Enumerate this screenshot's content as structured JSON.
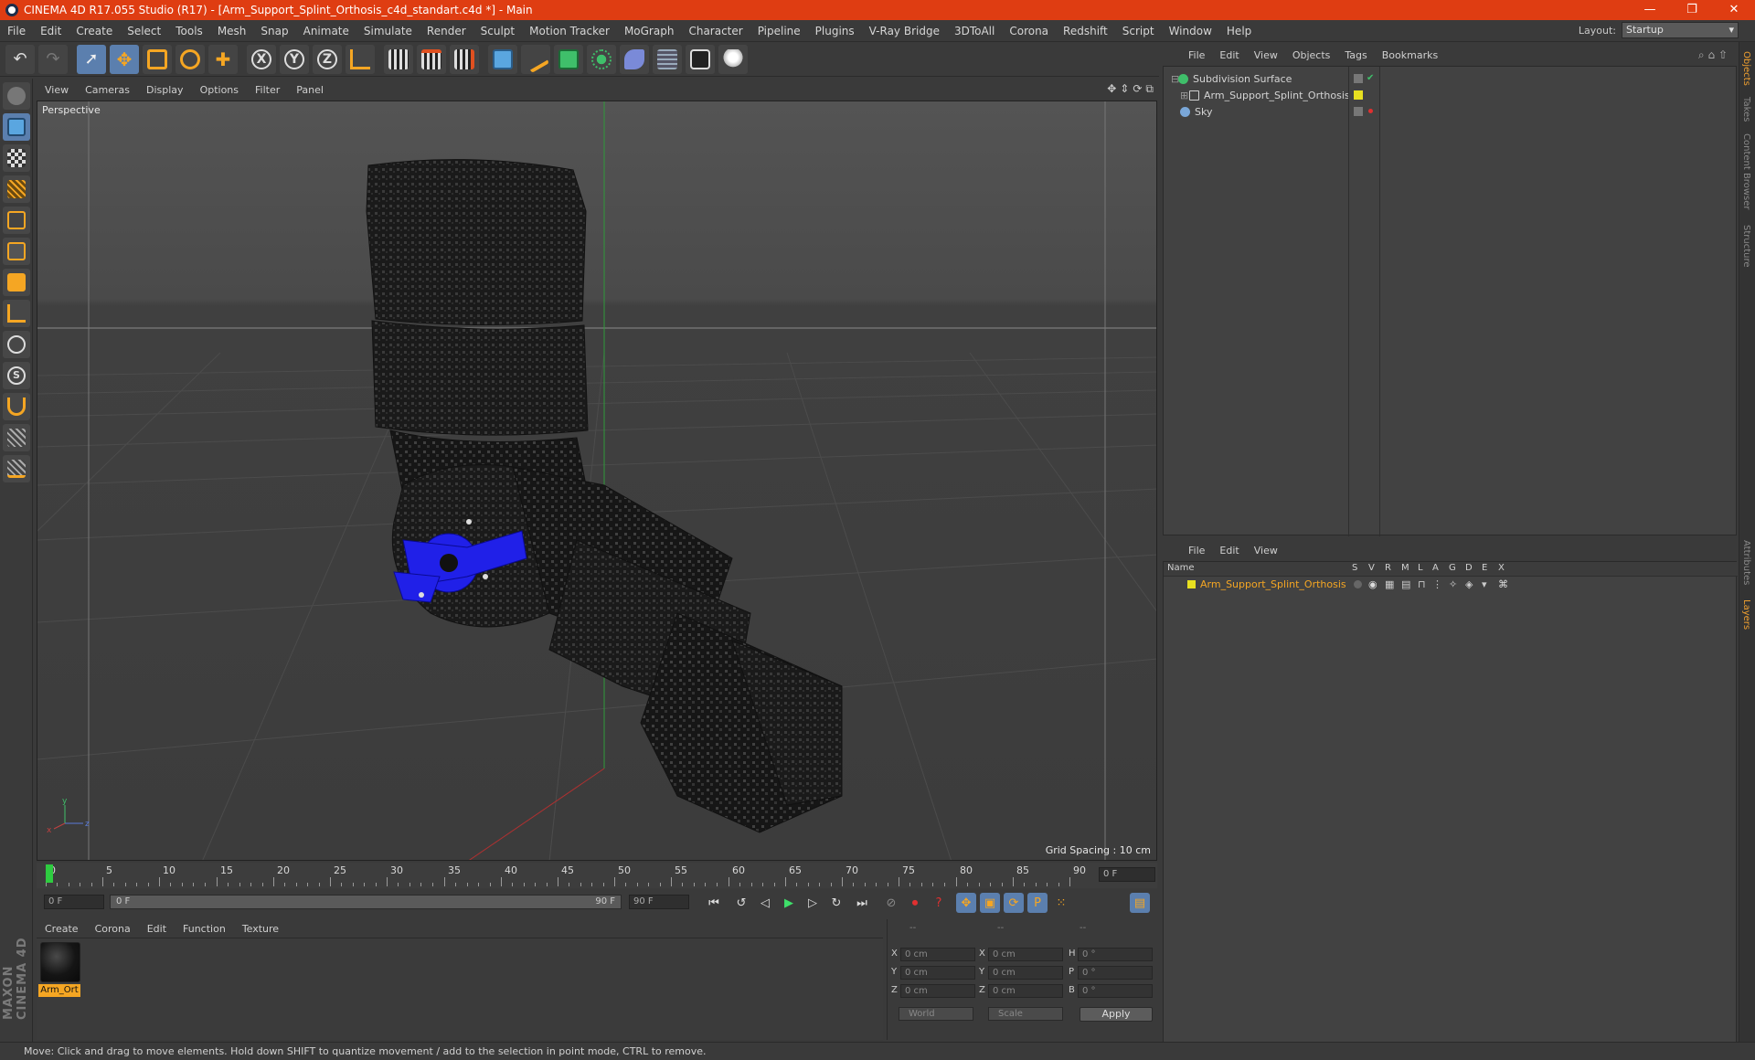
{
  "window": {
    "title": "CINEMA 4D R17.055 Studio (R17) - [Arm_Support_Splint_Orthosis_c4d_standart.c4d *] - Main",
    "controls": [
      "—",
      "❐",
      "✕"
    ]
  },
  "menubar": {
    "items": [
      "File",
      "Edit",
      "Create",
      "Select",
      "Tools",
      "Mesh",
      "Snap",
      "Animate",
      "Simulate",
      "Render",
      "Sculpt",
      "Motion Tracker",
      "MoGraph",
      "Character",
      "Pipeline",
      "Plugins",
      "V-Ray Bridge",
      "3DToAll",
      "Corona",
      "Redshift",
      "Script",
      "Window",
      "Help"
    ],
    "layout_label": "Layout:",
    "layout_value": "Startup"
  },
  "toolbar": {
    "axis_x": "X",
    "axis_y": "Y",
    "axis_z": "Z"
  },
  "viewport": {
    "menu": [
      "View",
      "Cameras",
      "Display",
      "Options",
      "Filter",
      "Panel"
    ],
    "camera_label": "Perspective",
    "grid_spacing": "Grid Spacing : 10 cm"
  },
  "timeline": {
    "ticks": [
      "0",
      "5",
      "10",
      "15",
      "20",
      "25",
      "30",
      "35",
      "40",
      "45",
      "50",
      "55",
      "60",
      "65",
      "70",
      "75",
      "80",
      "85",
      "90"
    ],
    "current_frame": "0 F",
    "start_frame": "0 F",
    "range_start": "0 F",
    "range_end": "90 F",
    "end_frame": "90 F"
  },
  "material_manager": {
    "menu": [
      "Create",
      "Corona",
      "Edit",
      "Function",
      "Texture"
    ],
    "materials": [
      {
        "name": "Arm_Ort"
      }
    ]
  },
  "coordinates": {
    "headers": [
      "--",
      "--",
      "--"
    ],
    "rows": [
      {
        "axis": "X",
        "pos": "0 cm",
        "axis2": "X",
        "size": "0 cm",
        "axis3": "H",
        "rot": "0 °"
      },
      {
        "axis": "Y",
        "pos": "0 cm",
        "axis2": "Y",
        "size": "0 cm",
        "axis3": "P",
        "rot": "0 °"
      },
      {
        "axis": "Z",
        "pos": "0 cm",
        "axis2": "Z",
        "size": "0 cm",
        "axis3": "B",
        "rot": "0 °"
      }
    ],
    "mode1": "World",
    "mode2": "Scale",
    "apply": "Apply"
  },
  "object_manager": {
    "menu": [
      "File",
      "Edit",
      "View",
      "Objects",
      "Tags",
      "Bookmarks"
    ],
    "objects": [
      {
        "name": "Subdivision Surface",
        "color": "#3fbf6a"
      },
      {
        "name": "Arm_Support_Splint_Orthosis",
        "color": "#d0d0d0"
      },
      {
        "name": "Sky",
        "color": "#7aa7d8"
      }
    ]
  },
  "layer_manager": {
    "menu": [
      "File",
      "Edit",
      "View"
    ],
    "columns": [
      "Name",
      "S",
      "V",
      "R",
      "M",
      "L",
      "A",
      "G",
      "D",
      "E",
      "X"
    ],
    "layers": [
      {
        "name": "Arm_Support_Splint_Orthosis",
        "color": "#e8e020"
      }
    ]
  },
  "right_tabs": [
    "Objects",
    "Takes",
    "Content Browser",
    "Structure",
    "Attributes",
    "Layers"
  ],
  "maxon": "MAXON CINEMA 4D",
  "status": "Move: Click and drag to move elements. Hold down SHIFT to quantize movement / add to the selection in point mode, CTRL to remove.",
  "colors": {
    "accent": "#df3d12",
    "selection": "#f5a623",
    "active_tool": "#5b7fae"
  }
}
